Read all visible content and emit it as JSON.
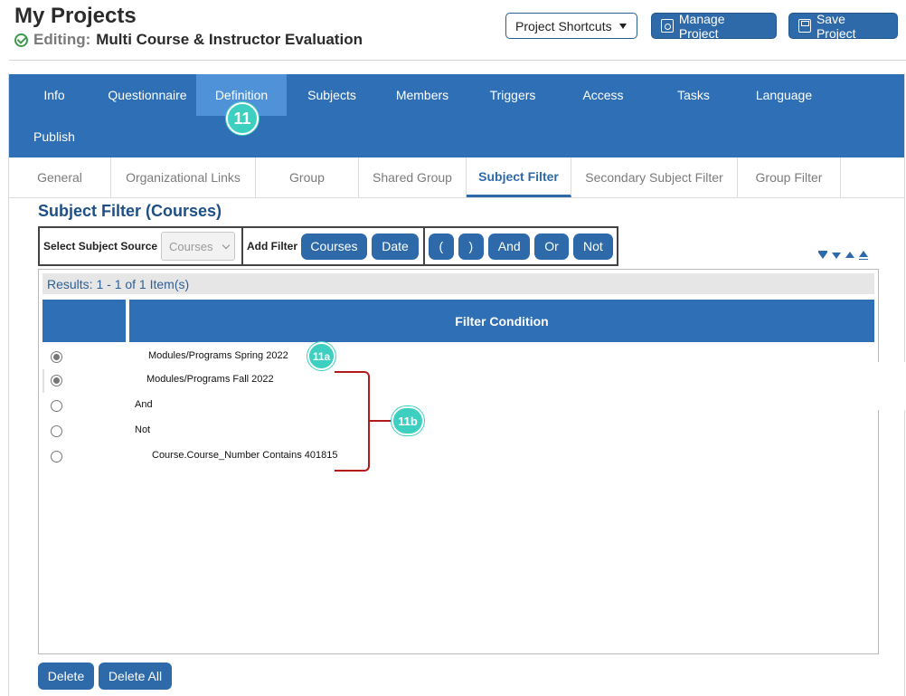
{
  "header": {
    "title": "My Projects",
    "editing_label": "Editing:",
    "project_name": "Multi Course & Instructor Evaluation",
    "shortcuts_label": "Project Shortcuts",
    "manage_label": "Manage Project",
    "save_label": "Save Project"
  },
  "main_nav": [
    {
      "label": "Info",
      "active": false
    },
    {
      "label": "Questionnaire",
      "active": false
    },
    {
      "label": "Definition",
      "active": true
    },
    {
      "label": "Subjects",
      "active": false
    },
    {
      "label": "Members",
      "active": false
    },
    {
      "label": "Triggers",
      "active": false
    },
    {
      "label": "Access",
      "active": false
    },
    {
      "label": "Tasks",
      "active": false
    },
    {
      "label": "Language",
      "active": false
    },
    {
      "label": "Publish",
      "active": false
    }
  ],
  "sub_tabs": [
    {
      "label": "General",
      "active": false
    },
    {
      "label": "Organizational Links",
      "active": false
    },
    {
      "label": "Group",
      "active": false
    },
    {
      "label": "Shared Group",
      "active": false
    },
    {
      "label": "Subject Filter",
      "active": true
    },
    {
      "label": "Secondary Subject Filter",
      "active": false
    },
    {
      "label": "Group Filter",
      "active": false
    }
  ],
  "section_title": "Subject Filter (Courses)",
  "toolbar": {
    "source_label": "Select Subject Source",
    "source_value": "Courses",
    "add_filter_label": "Add Filter",
    "add_buttons": [
      "Courses",
      "Date"
    ],
    "operators": [
      "(",
      ")",
      "And",
      "Or",
      "Not"
    ]
  },
  "grid": {
    "results_text": "Results: 1 - 1 of 1 Item(s)",
    "column_header": "Filter Condition",
    "rows": [
      {
        "text": "Modules/Programs Spring 2022",
        "selected": true
      },
      {
        "text": "Modules/Programs Fall 2022",
        "selected": true
      },
      {
        "text": "And",
        "selected": false
      },
      {
        "text": "Not",
        "selected": false
      },
      {
        "text": "Course.Course_Number Contains 401815",
        "selected": false
      }
    ]
  },
  "footer": {
    "delete_label": "Delete",
    "delete_all_label": "Delete All"
  },
  "annotations": {
    "badge_main": "11",
    "badge_a": "11a",
    "badge_b": "11b",
    "accent_color": "#3dcfc0",
    "bracket_color": "#b31b1b"
  },
  "colors": {
    "primary": "#2e6aa9",
    "nav_bg": "#2e6fb5",
    "nav_active": "#5092d8",
    "title_blue": "#1e4f86"
  }
}
